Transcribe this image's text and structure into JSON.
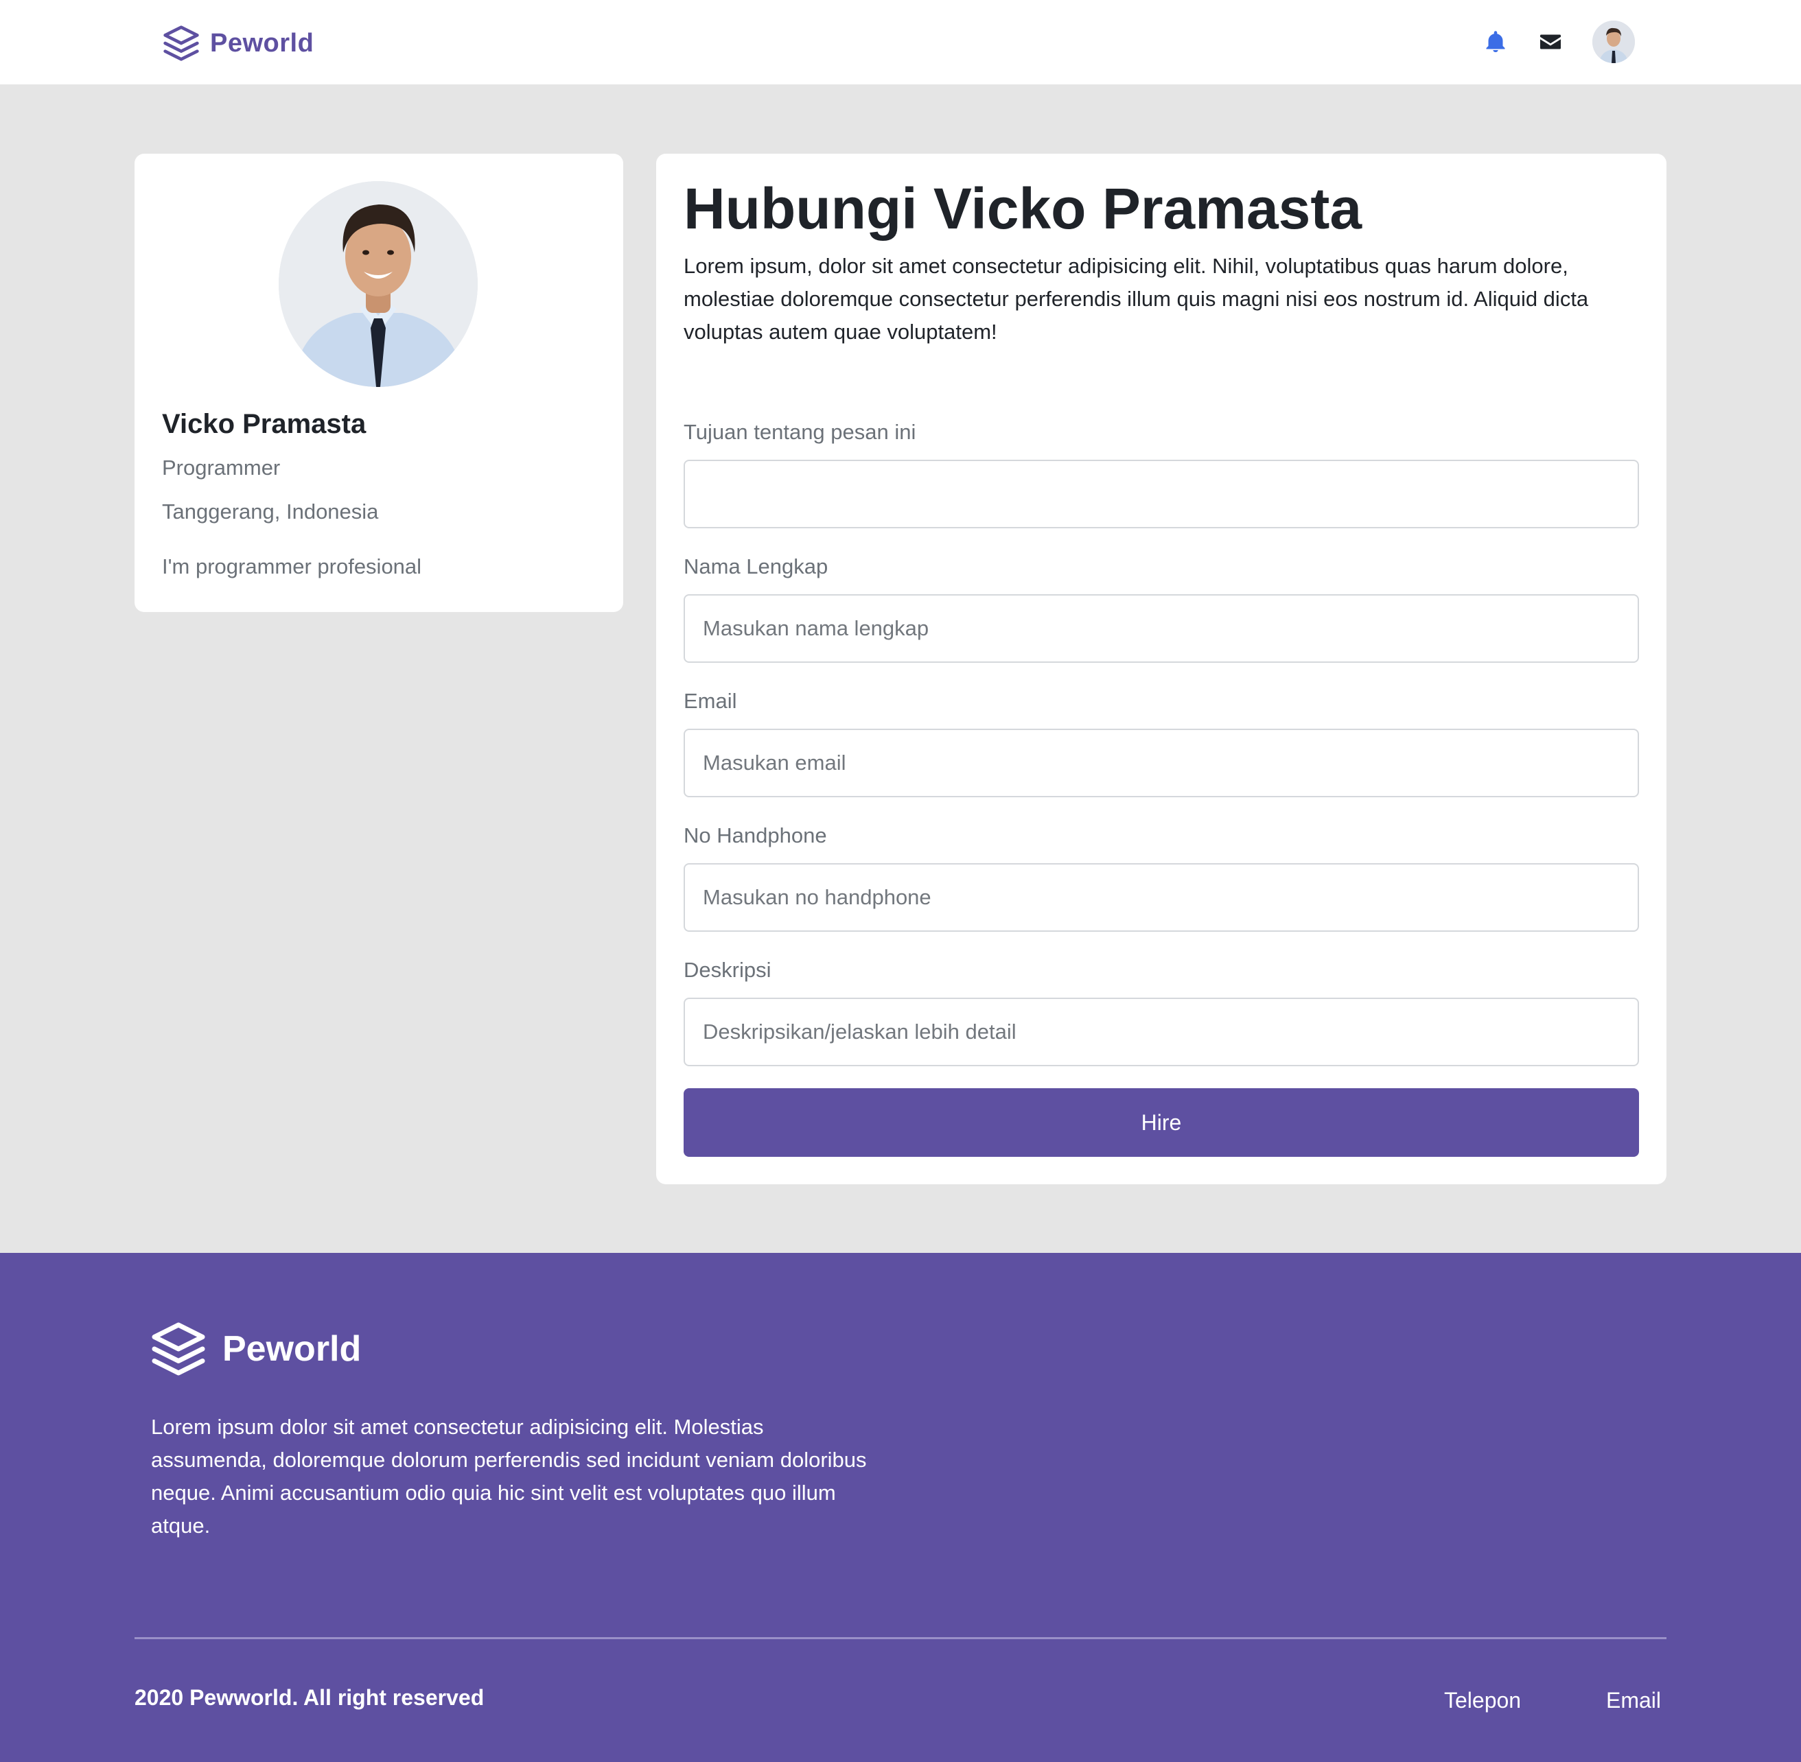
{
  "header": {
    "brand": "Peworld",
    "icons": [
      "bell-icon",
      "mail-icon"
    ],
    "bell_color": "#3b6de6"
  },
  "profile": {
    "name": "Vicko Pramasta",
    "job": "Programmer",
    "location": "Tanggerang, Indonesia",
    "bio": "I'm programmer profesional"
  },
  "contact": {
    "title": "Hubungi Vicko Pramasta",
    "description": "Lorem ipsum, dolor sit amet consectetur adipisicing elit. Nihil, voluptatibus quas harum dolore, molestiae doloremque consectetur perferendis illum quis magni nisi eos nostrum id. Aliquid dicta voluptas autem quae voluptatem!",
    "fields": [
      {
        "label": "Tujuan tentang pesan ini",
        "placeholder": "",
        "value": ""
      },
      {
        "label": "Nama Lengkap",
        "placeholder": "Masukan nama lengkap",
        "value": ""
      },
      {
        "label": "Email",
        "placeholder": "Masukan email",
        "value": ""
      },
      {
        "label": "No Handphone",
        "placeholder": "Masukan no handphone",
        "value": ""
      },
      {
        "label": "Deskripsi",
        "placeholder": "Deskripsikan/jelaskan lebih detail",
        "value": ""
      }
    ],
    "submit_label": "Hire"
  },
  "footer": {
    "brand": "Peworld",
    "description": "Lorem ipsum dolor sit amet consectetur adipisicing elit. Molestias assumenda, doloremque dolorum perferendis sed incidunt veniam doloribus neque. Animi accusantium odio quia hic sint velit est voluptates quo illum atque.",
    "copyright": "2020 Pewworld. All right reserved",
    "links": [
      "Telepon",
      "Email"
    ]
  },
  "colors": {
    "brand": "#5e50a1",
    "background": "#e5e5e5"
  }
}
